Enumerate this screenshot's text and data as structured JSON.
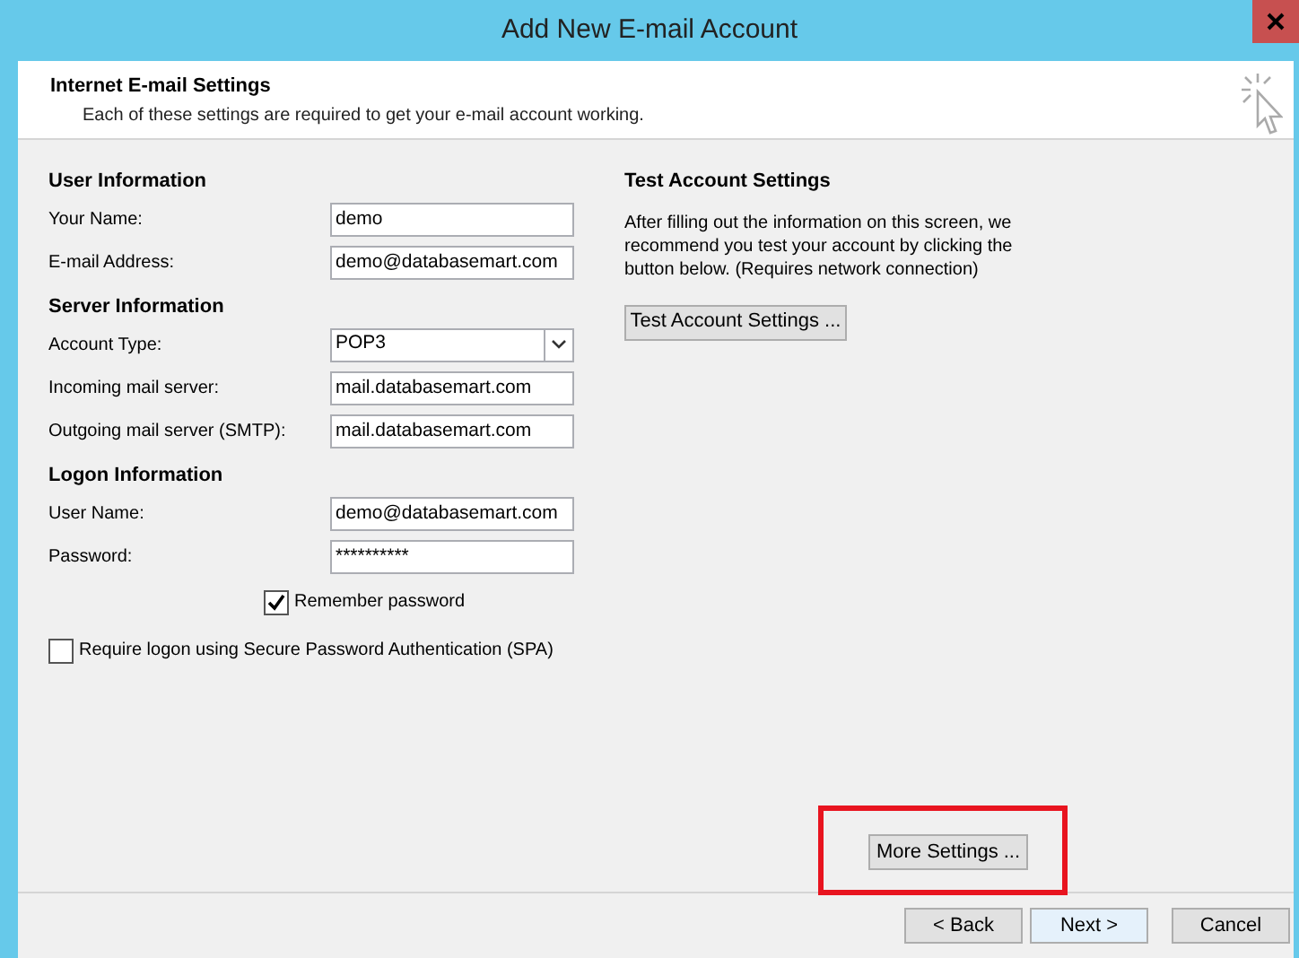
{
  "window": {
    "title": "Add New E-mail Account"
  },
  "header": {
    "title": "Internet E-mail Settings",
    "subtitle": "Each of these settings are required to get your e-mail account working."
  },
  "sections": [
    {
      "title": "User Information",
      "fields": [
        {
          "kind": "text",
          "label": "Your Name:",
          "value": "demo"
        },
        {
          "kind": "text",
          "label": "E-mail Address:",
          "value": "demo@databasemart.com"
        }
      ]
    },
    {
      "title": "Server Information",
      "fields": [
        {
          "kind": "select",
          "label": "Account Type:",
          "value": "POP3"
        },
        {
          "kind": "text",
          "label": "Incoming mail server:",
          "value": "mail.databasemart.com"
        },
        {
          "kind": "text",
          "label": "Outgoing mail server (SMTP):",
          "value": "mail.databasemart.com"
        }
      ]
    },
    {
      "title": "Logon Information",
      "fields": [
        {
          "kind": "text",
          "label": "User Name:",
          "value": "demo@databasemart.com"
        },
        {
          "kind": "password",
          "label": "Password:",
          "value": "**********"
        }
      ]
    }
  ],
  "remember_password": {
    "label": "Remember password",
    "checked": true
  },
  "spa": {
    "label": "Require logon using Secure Password Authentication (SPA)",
    "checked": false
  },
  "test": {
    "title": "Test Account Settings",
    "description": "After filling out the information on this screen, we recommend you test your account by clicking the button below. (Requires network connection)",
    "button": "Test Account Settings ..."
  },
  "more_settings": {
    "label": "More Settings ...",
    "highlighted": true
  },
  "buttons": [
    {
      "label": "< Back",
      "focused": false
    },
    {
      "label": "Next >",
      "focused": true
    },
    {
      "label": "Cancel",
      "focused": false
    }
  ]
}
